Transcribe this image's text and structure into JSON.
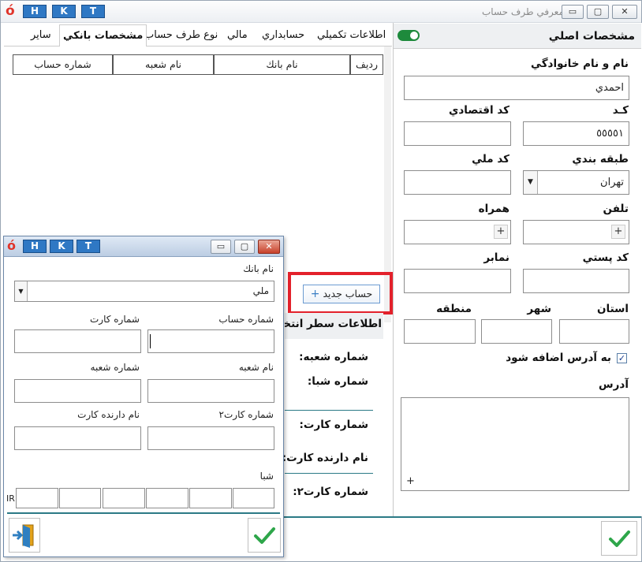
{
  "window": {
    "title": "معرفي طرف حساب",
    "logo": "ó",
    "hkt": [
      "H",
      "K",
      "T"
    ],
    "controls": {
      "minimize": "▭",
      "maximize": "▢",
      "close": "✕"
    }
  },
  "main": {
    "section_title": "مشخصات اصلي",
    "name_label": "نام و نام خانوادگي",
    "name_value": "احمدي",
    "code_label": "كـد",
    "code_value": "٥٥٥٥١",
    "economic_code_label": "كد اقتصادي",
    "category_label": "طبقه بندي",
    "category_value": "تهران",
    "national_code_label": "كد ملي",
    "phone_label": "تلفن",
    "mobile_label": "همراه",
    "postal_code_label": "كد پستي",
    "fax_label": "نمابر",
    "province_label": "استان",
    "city_label": "شهر",
    "region_label": "منطقه",
    "add_to_address_label": "به آدرس اضافه شود",
    "address_label": "آدرس",
    "plus": "+"
  },
  "tabs": [
    "اطلاعات تكميلي",
    "حسابداري",
    "مالي",
    "نوع طرف حساب",
    "مشخصات بانكي",
    "ساير"
  ],
  "grid": {
    "headers": [
      "رديف",
      "نام بانك",
      "نام شعبه",
      "شماره حساب"
    ]
  },
  "new_account_button": "حساب جديد",
  "row_info": {
    "title": "اطلاعات سطر انتخاب",
    "branch_no": "شماره شعبه:",
    "sheba_no": "شماره شبا:",
    "card_no": "شماره كارت:",
    "card_holder": "نام دارنده كارت:",
    "card_no2": "شماره كارت۲:"
  },
  "dialog": {
    "bank_name_label": "نام بانك",
    "bank_name_value": "ملي",
    "account_no_label": "شماره حساب",
    "card_no_label": "شماره كارت",
    "branch_name_label": "نام شعبه",
    "branch_no_label": "شماره شعبه",
    "card_no2_label": "شماره كارت۲",
    "card_holder_label": "نام دارنده كارت",
    "sheba_label": "شبا",
    "sheba_prefix": "IR"
  }
}
